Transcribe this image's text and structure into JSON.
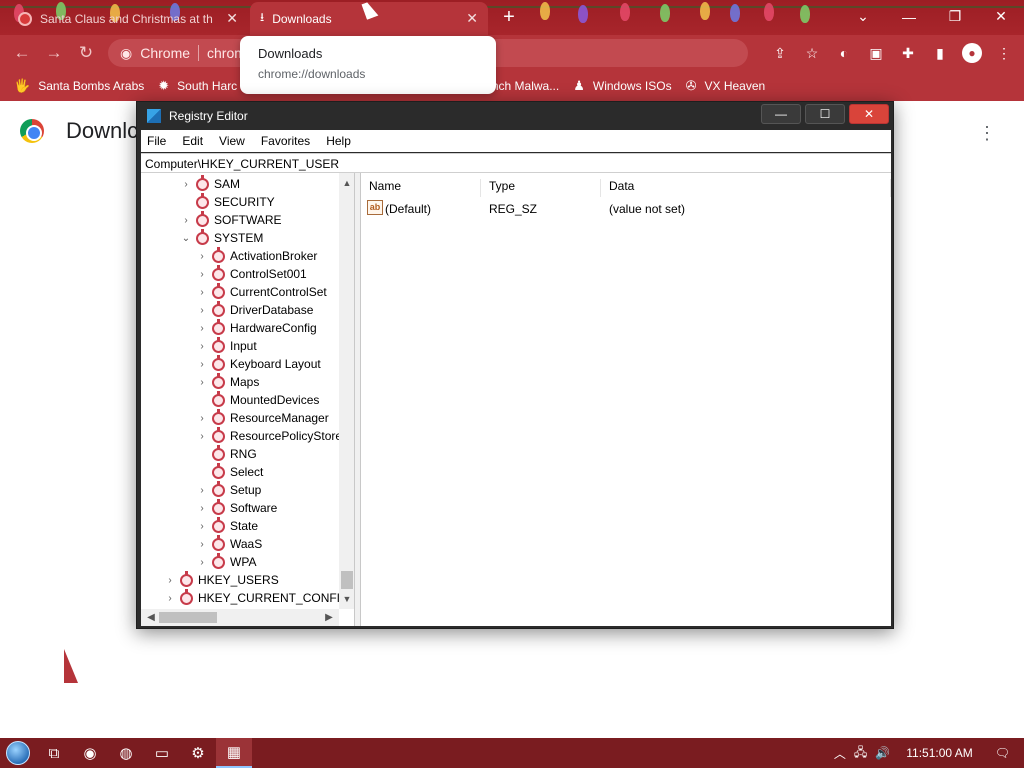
{
  "chrome": {
    "tabs": [
      {
        "title": "Santa Claus and Christmas at th",
        "active": false
      },
      {
        "title": "Downloads",
        "active": true
      }
    ],
    "omnibox": {
      "site_label": "Chrome",
      "url": "chrom"
    },
    "bookmarks": [
      "Santa Bombs Arabs",
      "South Harc",
      "anch Malwa...",
      "Windows ISOs",
      "VX Heaven"
    ],
    "hovercard": {
      "title": "Downloads",
      "url": "chrome://downloads"
    },
    "page_title": "Downlc"
  },
  "regedit": {
    "title": "Registry Editor",
    "menu": [
      "File",
      "Edit",
      "View",
      "Favorites",
      "Help"
    ],
    "address": "Computer\\HKEY_CURRENT_USER",
    "tree": [
      {
        "label": "SAM",
        "level": 1,
        "expander": "›"
      },
      {
        "label": "SECURITY",
        "level": 1,
        "expander": ""
      },
      {
        "label": "SOFTWARE",
        "level": 1,
        "expander": "›"
      },
      {
        "label": "SYSTEM",
        "level": 1,
        "expander": "⌄"
      },
      {
        "label": "ActivationBroker",
        "level": 2,
        "expander": "›"
      },
      {
        "label": "ControlSet001",
        "level": 2,
        "expander": "›"
      },
      {
        "label": "CurrentControlSet",
        "level": 2,
        "expander": "›"
      },
      {
        "label": "DriverDatabase",
        "level": 2,
        "expander": "›"
      },
      {
        "label": "HardwareConfig",
        "level": 2,
        "expander": "›"
      },
      {
        "label": "Input",
        "level": 2,
        "expander": "›"
      },
      {
        "label": "Keyboard Layout",
        "level": 2,
        "expander": "›"
      },
      {
        "label": "Maps",
        "level": 2,
        "expander": "›"
      },
      {
        "label": "MountedDevices",
        "level": 2,
        "expander": ""
      },
      {
        "label": "ResourceManager",
        "level": 2,
        "expander": "›"
      },
      {
        "label": "ResourcePolicyStore",
        "level": 2,
        "expander": "›"
      },
      {
        "label": "RNG",
        "level": 2,
        "expander": ""
      },
      {
        "label": "Select",
        "level": 2,
        "expander": ""
      },
      {
        "label": "Setup",
        "level": 2,
        "expander": "›"
      },
      {
        "label": "Software",
        "level": 2,
        "expander": "›"
      },
      {
        "label": "State",
        "level": 2,
        "expander": "›"
      },
      {
        "label": "WaaS",
        "level": 2,
        "expander": "›"
      },
      {
        "label": "WPA",
        "level": 2,
        "expander": "›"
      },
      {
        "label": "HKEY_USERS",
        "level": 0,
        "expander": "›"
      },
      {
        "label": "HKEY_CURRENT_CONFIG",
        "level": 0,
        "expander": "›"
      }
    ],
    "columns": [
      "Name",
      "Type",
      "Data"
    ],
    "values": [
      {
        "name": "(Default)",
        "type": "REG_SZ",
        "data": "(value not set)",
        "icon": "ab"
      }
    ]
  },
  "taskbar": {
    "clock": "11:51:00 AM"
  }
}
